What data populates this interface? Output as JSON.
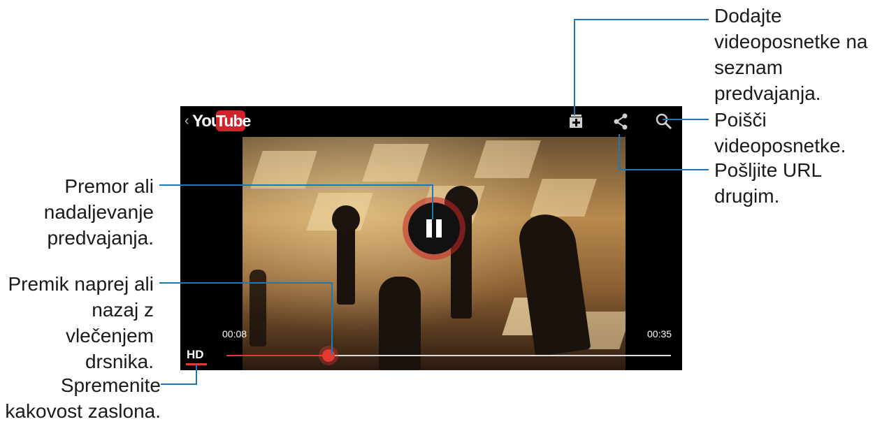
{
  "player": {
    "back_glyph": "‹",
    "logo_you": "You",
    "logo_tube": "Tube",
    "elapsed_time": "00:08",
    "total_time": "00:35",
    "quality_label": "HD",
    "progress_fraction": 0.23
  },
  "icons": {
    "add_to_playlist": "add-to-playlist-icon",
    "share": "share-icon",
    "search": "search-icon",
    "pause": "pause-icon"
  },
  "callouts": {
    "add_to_playlist": [
      "Dodajte",
      "videoposnetke na",
      "seznam",
      "predvajanja."
    ],
    "search": [
      "Poišči",
      "videoposnetke."
    ],
    "share": "Pošljite URL drugim.",
    "pause": [
      "Premor ali",
      "nadaljevanje",
      "predvajanja."
    ],
    "seek": [
      "Premik naprej ali",
      "nazaj z vlečenjem",
      "drsnika."
    ],
    "quality": [
      "Spremenite",
      "kakovost zaslona."
    ]
  },
  "colors": {
    "youtube_red": "#d2232a",
    "seek_red": "#e53935",
    "callout_line": "#1f78b4"
  }
}
